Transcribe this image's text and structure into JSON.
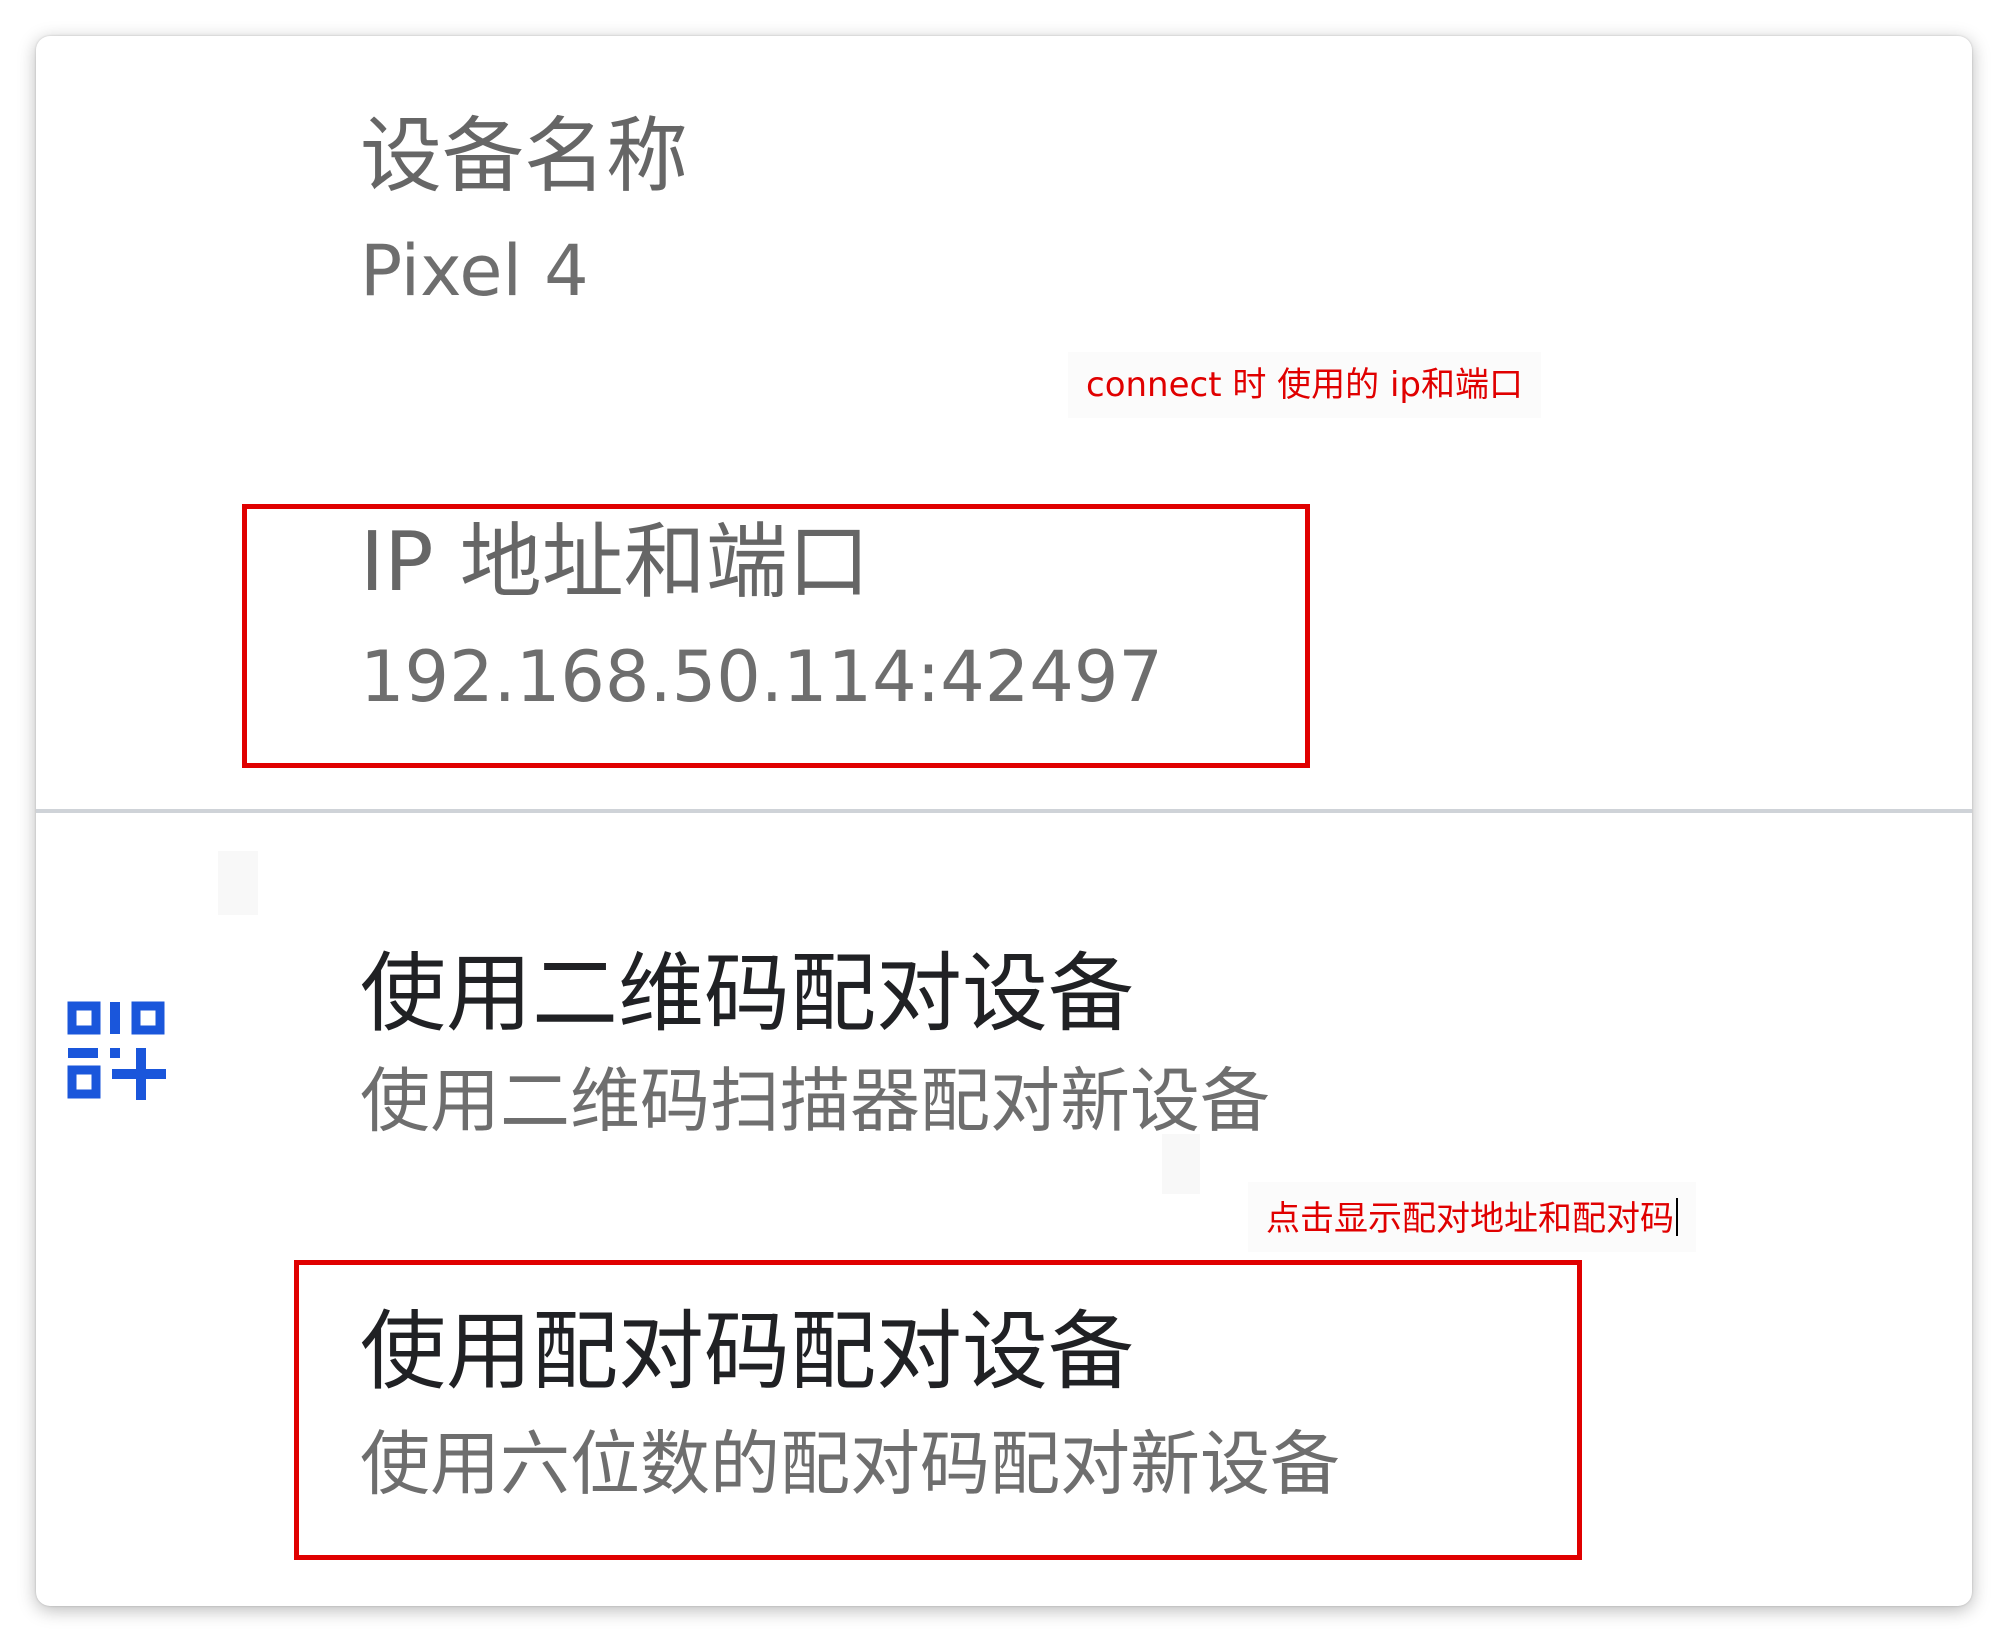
{
  "device_name": {
    "label": "设备名称",
    "value": "Pixel 4"
  },
  "ip_port": {
    "label": "IP 地址和端口",
    "value": "192.168.50.114:42497"
  },
  "annotations": {
    "ip_note": "connect 时 使用的 ip和端口",
    "pair_note": "点击显示配对地址和配对码"
  },
  "pair_qr": {
    "title": "使用二维码配对设备",
    "subtitle": "使用二维码扫描器配对新设备",
    "icon": "qr-code-add-icon"
  },
  "pair_code": {
    "title": "使用配对码配对设备",
    "subtitle": "使用六位数的配对码配对新设备"
  },
  "colors": {
    "annotation_red": "#e00000",
    "icon_blue": "#1a56db"
  }
}
